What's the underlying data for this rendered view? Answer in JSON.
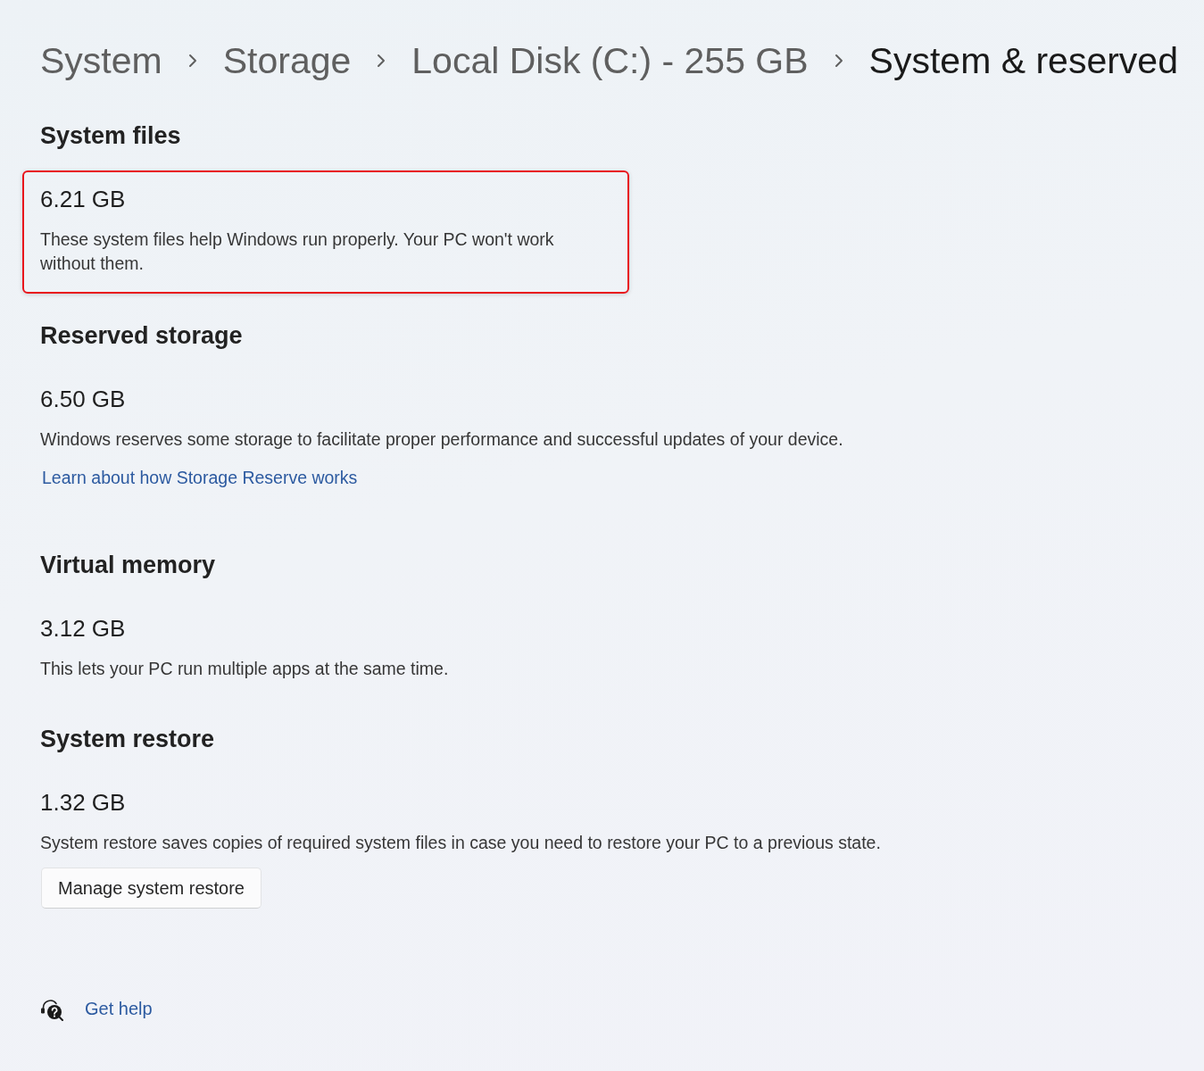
{
  "breadcrumb": [
    {
      "label": "System",
      "current": false
    },
    {
      "label": "Storage",
      "current": false
    },
    {
      "label": "Local Disk (C:) - 255 GB",
      "current": false
    },
    {
      "label": "System & reserved",
      "current": true
    }
  ],
  "sections": [
    {
      "heading": "System files",
      "size": "6.21 GB",
      "description": "These system files help Windows run properly. Your PC won't work without them.",
      "highlighted": true
    },
    {
      "heading": "Reserved storage",
      "size": "6.50 GB",
      "description": "Windows reserves some storage to facilitate proper performance and successful updates of your device.",
      "link": "Learn about how Storage Reserve works",
      "highlighted": false
    },
    {
      "heading": "Virtual memory",
      "size": "3.12 GB",
      "description": "This lets your PC run multiple apps at the same time.",
      "highlighted": false
    },
    {
      "heading": "System restore",
      "size": "1.32 GB",
      "description": "System restore saves copies of required system files in case you need to restore your PC to a previous state.",
      "button": "Manage system restore",
      "highlighted": false
    }
  ],
  "help": {
    "label": "Get help"
  }
}
